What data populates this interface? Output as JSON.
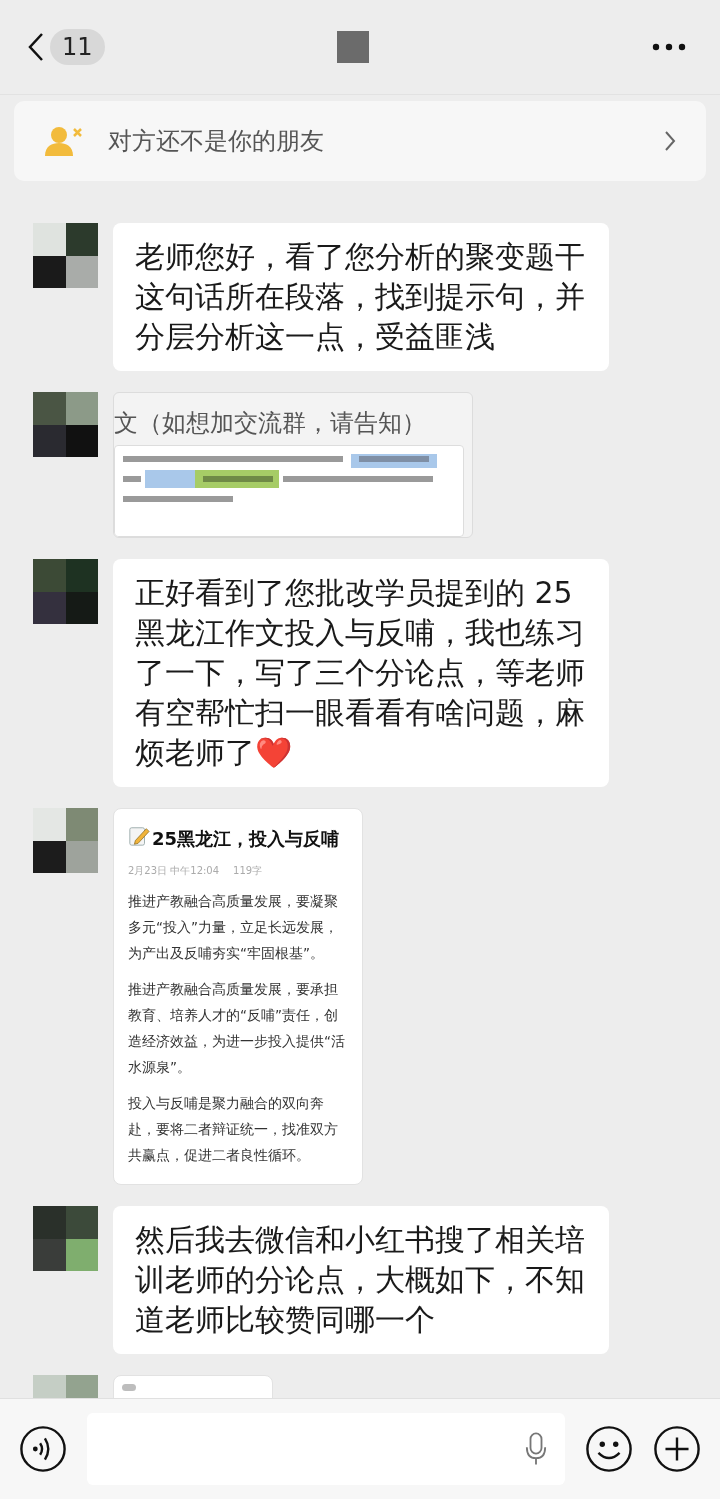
{
  "header": {
    "back_count": "11"
  },
  "banner": {
    "text": "对方还不是你的朋友"
  },
  "messages": [
    {
      "kind": "text",
      "text": "老师您好，看了您分析的聚变题干这句话所在段落，找到提示句，并分层分析这一点，受益匪浅"
    },
    {
      "kind": "image",
      "heading": "文（如想加交流群，请告知）"
    },
    {
      "kind": "text",
      "text": "正好看到了您批改学员提到的 25 黑龙江作文投入与反哺，我也练习了一下，写了三个分论点，等老师有空帮忙扫一眼看看有啥问题，麻烦老师了❤️"
    },
    {
      "kind": "note",
      "title": "25黑龙江，投入与反哺",
      "meta": "2月23日 中午12:04",
      "count": "119字",
      "paragraphs": [
        "推进产教融合高质量发展，要凝聚多元“投入”力量，立足长远发展，为产出及反哺夯实“牢固根基”。",
        "推进产教融合高质量发展，要承担教育、培养人才的“反哺”责任，创造经济效益，为进一步投入提供“活水源泉”。",
        "投入与反哺是聚力融合的双向奔赴，要将二者辩证统一，找准双方共赢点，促进二者良性循环。"
      ]
    },
    {
      "kind": "text",
      "text": "然后我去微信和小红书搜了相关培训老师的分论点，大概如下，不知道老师比较赞同哪一个"
    },
    {
      "kind": "partial"
    }
  ]
}
